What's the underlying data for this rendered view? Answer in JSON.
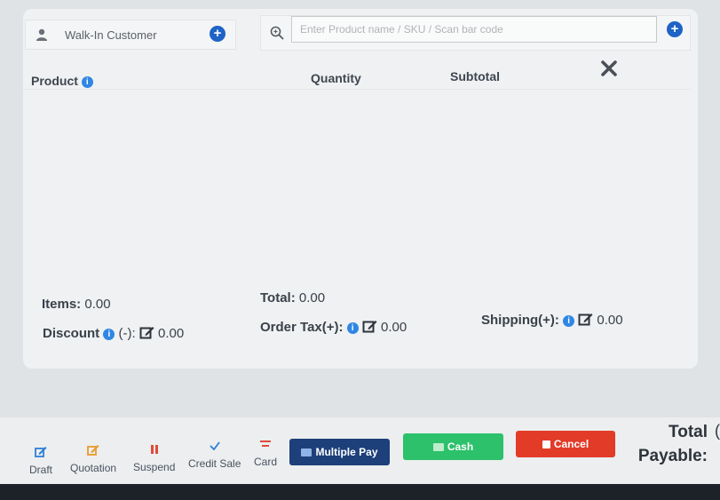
{
  "customer": {
    "name": "Walk-In Customer",
    "icon": "person-icon",
    "add_icon": "plus-circle-icon"
  },
  "search": {
    "placeholder": "Enter Product name / SKU / Scan bar code",
    "icon": "search-icon",
    "add_icon": "plus-circle-icon"
  },
  "table": {
    "headers": {
      "product": "Product",
      "quantity": "Quantity",
      "subtotal": "Subtotal"
    },
    "rows": []
  },
  "summary": {
    "items_label": "Items:",
    "items_value": "0.00",
    "total_label": "Total:",
    "total_value": "0.00",
    "discount_label": "Discount",
    "discount_sign": "(-):",
    "discount_value": "0.00",
    "order_tax_label": "Order Tax(+):",
    "order_tax_value": "0.00",
    "shipping_label": "Shipping(+):",
    "shipping_value": "0.00"
  },
  "footer": {
    "draft": "Draft",
    "quotation": "Quotation",
    "suspend": "Suspend",
    "credit_sale": "Credit Sale",
    "card": "Card",
    "multiple_pay": "Multiple Pay",
    "cash": "Cash",
    "cancel": "Cancel",
    "total_payable_line1": "Total",
    "total_payable_line2": "Payable:",
    "total_payable_paren": "("
  },
  "colors": {
    "primary": "#1e63c6",
    "info": "#2f86e4",
    "cash": "#2cc16a",
    "cancel": "#e23b28",
    "multiple_pay": "#1d3f7a"
  }
}
